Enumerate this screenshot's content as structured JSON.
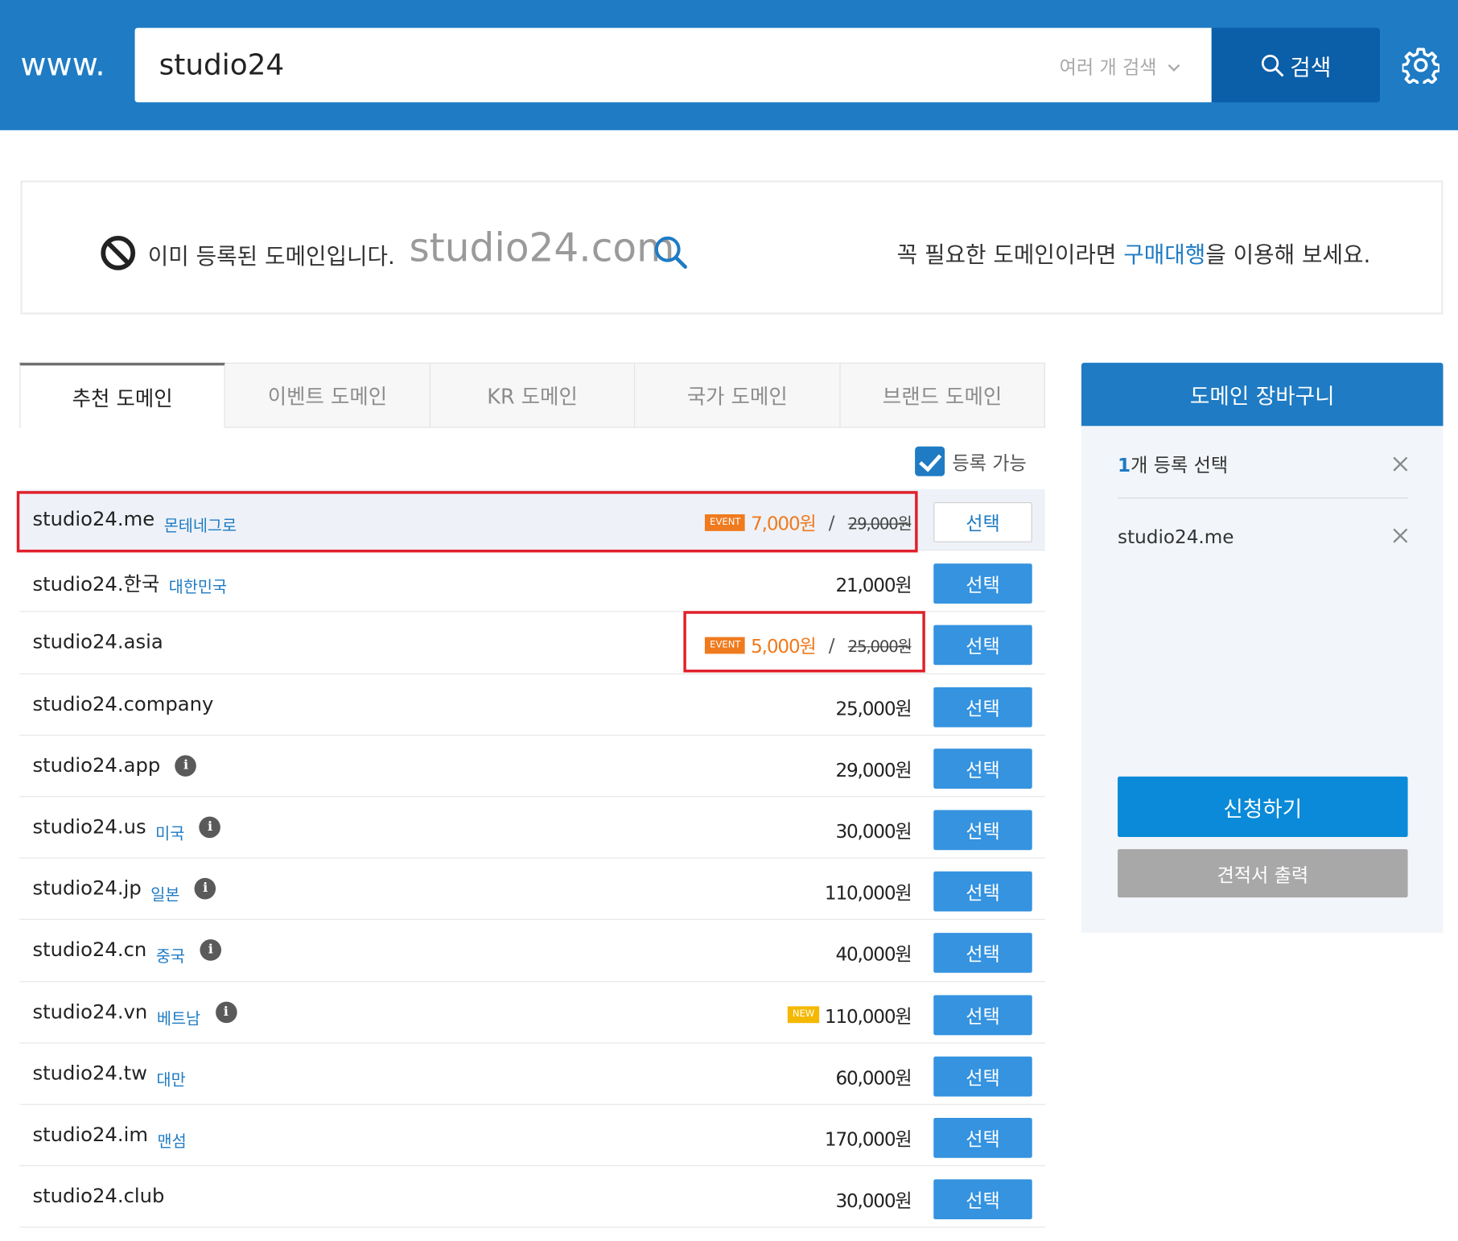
{
  "header": {
    "prefix": "www.",
    "search_value": "studio24",
    "multi_search_label": "여러 개 검색",
    "search_button_label": "검색",
    "brand_color": "#1e7bc4"
  },
  "notice": {
    "status_text": "이미 등록된 도메인입니다.",
    "domain": "studio24.com",
    "suggest_prefix": "꼭 필요한 도메인이라면 ",
    "suggest_link": "구매대행",
    "suggest_suffix": "을 이용해 보세요."
  },
  "tabs": [
    {
      "label": "추천 도메인",
      "active": true
    },
    {
      "label": "이벤트 도메인",
      "active": false
    },
    {
      "label": "KR 도메인",
      "active": false
    },
    {
      "label": "국가 도메인",
      "active": false
    },
    {
      "label": "브랜드 도메인",
      "active": false
    }
  ],
  "filter": {
    "label": "등록 가능",
    "checked": true
  },
  "domains": [
    {
      "name": "studio24.me",
      "country": "몬테네그로",
      "info": false,
      "badge": "EVENT",
      "price": "7,000원",
      "old_price": "29,000원",
      "button": "선택",
      "selected": true
    },
    {
      "name": "studio24.한국",
      "country": "대한민국",
      "info": false,
      "badge": "",
      "price": "21,000원",
      "old_price": "",
      "button": "선택",
      "selected": false
    },
    {
      "name": "studio24.asia",
      "country": "",
      "info": false,
      "badge": "EVENT",
      "price": "5,000원",
      "old_price": "25,000원",
      "button": "선택",
      "selected": false
    },
    {
      "name": "studio24.company",
      "country": "",
      "info": false,
      "badge": "",
      "price": "25,000원",
      "old_price": "",
      "button": "선택",
      "selected": false
    },
    {
      "name": "studio24.app",
      "country": "",
      "info": true,
      "badge": "",
      "price": "29,000원",
      "old_price": "",
      "button": "선택",
      "selected": false
    },
    {
      "name": "studio24.us",
      "country": "미국",
      "info": true,
      "badge": "",
      "price": "30,000원",
      "old_price": "",
      "button": "선택",
      "selected": false
    },
    {
      "name": "studio24.jp",
      "country": "일본",
      "info": true,
      "badge": "",
      "price": "110,000원",
      "old_price": "",
      "button": "선택",
      "selected": false
    },
    {
      "name": "studio24.cn",
      "country": "중국",
      "info": true,
      "badge": "",
      "price": "40,000원",
      "old_price": "",
      "button": "선택",
      "selected": false
    },
    {
      "name": "studio24.vn",
      "country": "베트남",
      "info": true,
      "badge": "NEW",
      "price": "110,000원",
      "old_price": "",
      "button": "선택",
      "selected": false
    },
    {
      "name": "studio24.tw",
      "country": "대만",
      "info": false,
      "badge": "",
      "price": "60,000원",
      "old_price": "",
      "button": "선택",
      "selected": false
    },
    {
      "name": "studio24.im",
      "country": "맨섬",
      "info": false,
      "badge": "",
      "price": "170,000원",
      "old_price": "",
      "button": "선택",
      "selected": false
    },
    {
      "name": "studio24.club",
      "country": "",
      "info": false,
      "badge": "",
      "price": "30,000원",
      "old_price": "",
      "button": "선택",
      "selected": false
    }
  ],
  "cart": {
    "title": "도메인 장바구니",
    "count_num": "1",
    "count_text": "개 등록 선택",
    "items": [
      "studio24.me"
    ],
    "apply_label": "신청하기",
    "quote_label": "견적서 출력"
  }
}
